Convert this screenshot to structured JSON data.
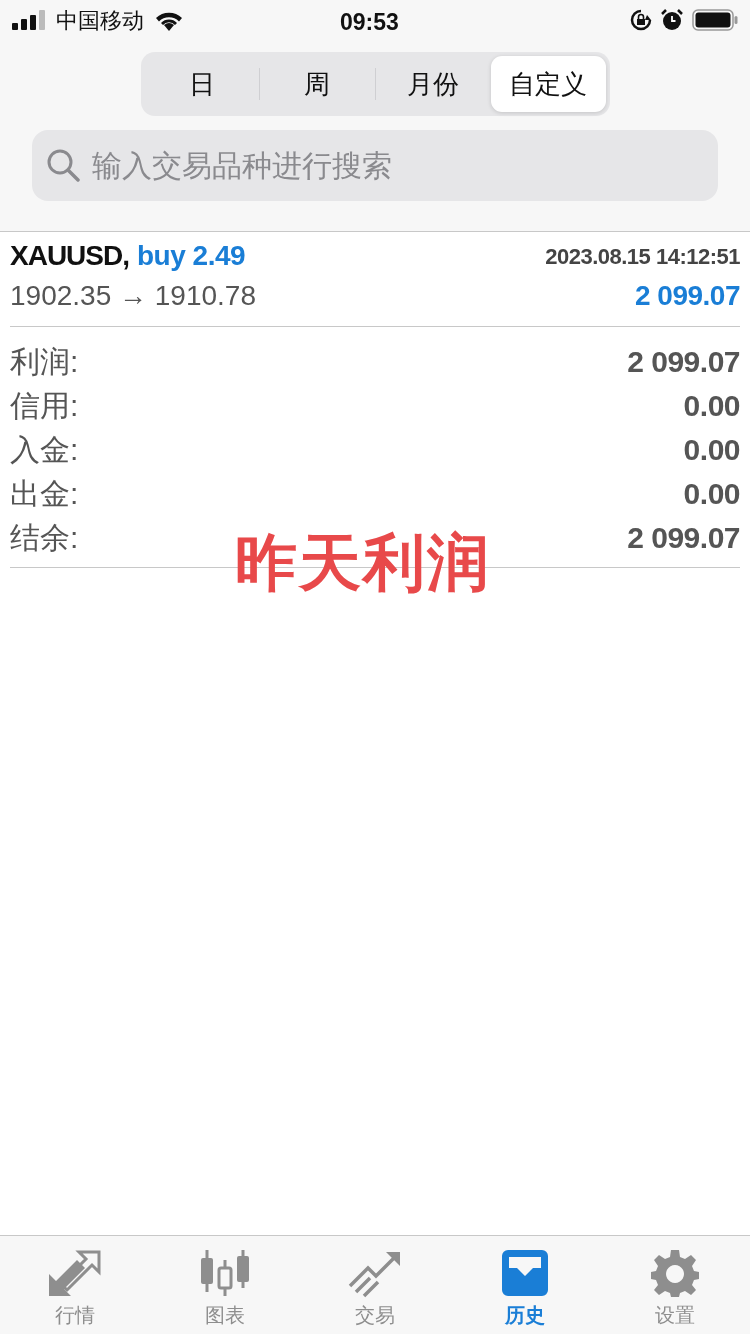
{
  "status_bar": {
    "carrier": "中国移动",
    "time": "09:53"
  },
  "period_tabs": [
    {
      "label": "日",
      "selected": false
    },
    {
      "label": "周",
      "selected": false
    },
    {
      "label": "月份",
      "selected": false
    },
    {
      "label": "自定义",
      "selected": true
    }
  ],
  "search": {
    "placeholder": "输入交易品种进行搜索"
  },
  "deal": {
    "symbol": "XAUUSD,",
    "side": "buy 2.49",
    "time": "2023.08.15 14:12:51",
    "prices": "1902.35 → 1910.78",
    "profit": "2 099.07"
  },
  "summary": [
    {
      "label": "利润:",
      "value": "2 099.07"
    },
    {
      "label": "信用:",
      "value": "0.00"
    },
    {
      "label": "入金:",
      "value": "0.00"
    },
    {
      "label": "出金:",
      "value": "0.00"
    },
    {
      "label": "结余:",
      "value": "2 099.07"
    }
  ],
  "annotation": "昨天利润",
  "tab_bar": [
    {
      "label": "行情",
      "kind": "quotes",
      "selected": false
    },
    {
      "label": "图表",
      "kind": "chart",
      "selected": false
    },
    {
      "label": "交易",
      "kind": "trade",
      "selected": false
    },
    {
      "label": "历史",
      "kind": "history",
      "selected": true
    },
    {
      "label": "设置",
      "kind": "settings",
      "selected": false
    }
  ]
}
